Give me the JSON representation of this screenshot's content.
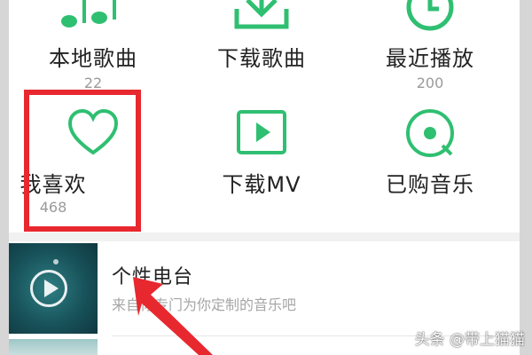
{
  "colors": {
    "accent": "#2fbf71",
    "highlight": "#e8282f",
    "text": "#222222",
    "muted": "#9a9a9a"
  },
  "grid": {
    "row1": [
      {
        "label": "本地歌曲",
        "count": "22",
        "icon": "music-note-icon"
      },
      {
        "label": "下载歌曲",
        "icon": "download-icon"
      },
      {
        "label": "最近播放",
        "count": "200",
        "icon": "clock-icon"
      }
    ],
    "row2": [
      {
        "label": "我喜欢",
        "count": "468",
        "icon": "heart-icon"
      },
      {
        "label": "下载MV",
        "icon": "mv-play-icon"
      },
      {
        "label": "已购音乐",
        "icon": "purchased-music-icon"
      }
    ]
  },
  "radio": {
    "title": "个性电台",
    "subtitle": "来自你专门为你定制的音乐吧"
  },
  "watermark": "头条 @带上猫猫"
}
